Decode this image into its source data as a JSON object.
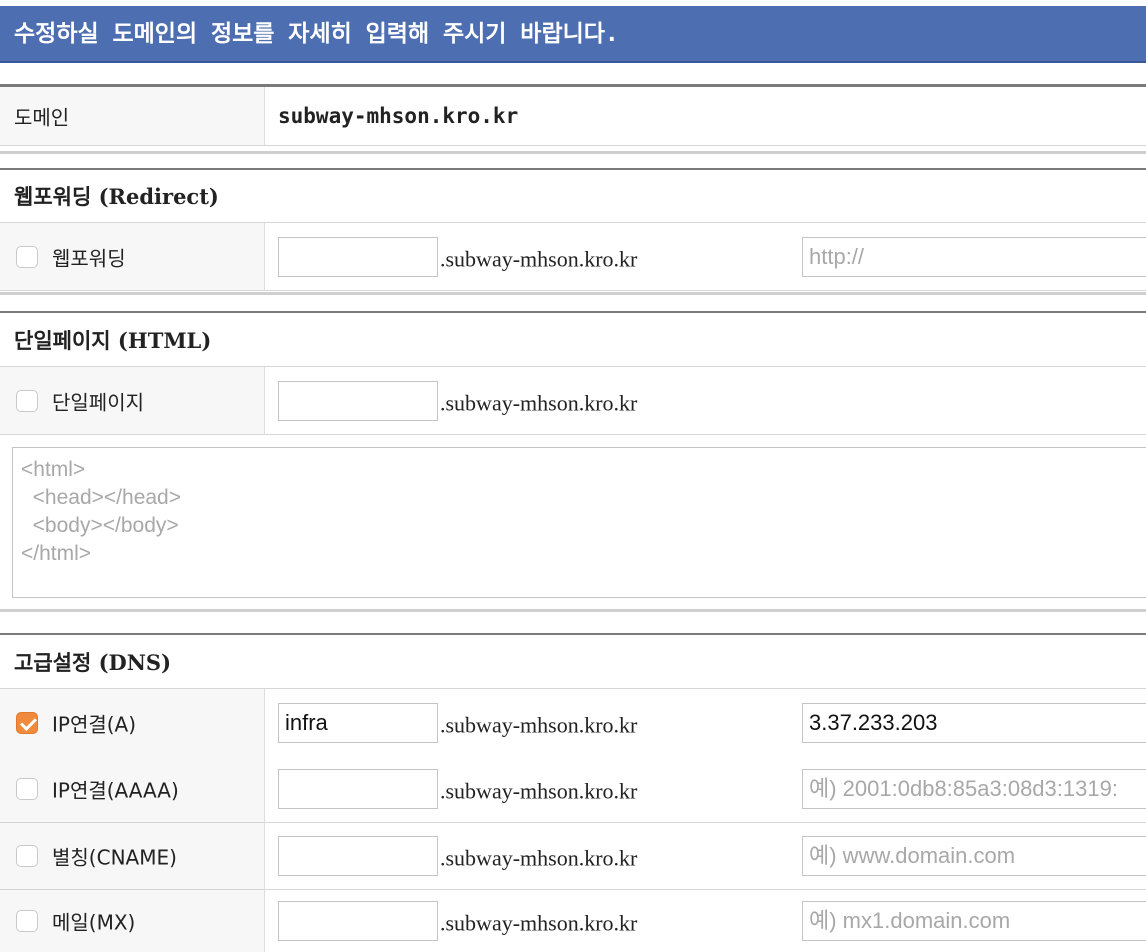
{
  "header": {
    "title": "수정하실 도메인의 정보를 자세히 입력해 주시기 바랍니다."
  },
  "domain_row": {
    "label": "도메인",
    "value": "subway-mhson.kro.kr"
  },
  "redirect": {
    "title": "웹포워딩 (Redirect)",
    "label": "웹포워딩",
    "checked": false,
    "subdomain": "",
    "suffix": ".subway-mhson.kro.kr",
    "url_placeholder": "http://"
  },
  "html_page": {
    "title": "단일페이지 (HTML)",
    "label": "단일페이지",
    "checked": false,
    "subdomain": "",
    "suffix": ".subway-mhson.kro.kr",
    "html_placeholder": "<html>\n  <head></head>\n  <body></body>\n</html>"
  },
  "dns": {
    "title": "고급설정 (DNS)",
    "records": [
      {
        "label": "IP연결(A)",
        "checked": true,
        "subdomain": "infra",
        "suffix": ".subway-mhson.kro.kr",
        "value": "3.37.233.203",
        "placeholder": ""
      },
      {
        "label": "IP연결(AAAA)",
        "checked": false,
        "subdomain": "",
        "suffix": ".subway-mhson.kro.kr",
        "value": "",
        "placeholder": "예) 2001:0db8:85a3:08d3:1319:"
      },
      {
        "label": "별칭(CNAME)",
        "checked": false,
        "subdomain": "",
        "suffix": ".subway-mhson.kro.kr",
        "value": "",
        "placeholder": "예) www.domain.com"
      },
      {
        "label": "메일(MX)",
        "checked": false,
        "subdomain": "",
        "suffix": ".subway-mhson.kro.kr",
        "value": "",
        "placeholder": "예) mx1.domain.com"
      }
    ]
  },
  "colors": {
    "header_bg": "#4d6eb0",
    "checkbox_checked": "#f08a3c"
  }
}
